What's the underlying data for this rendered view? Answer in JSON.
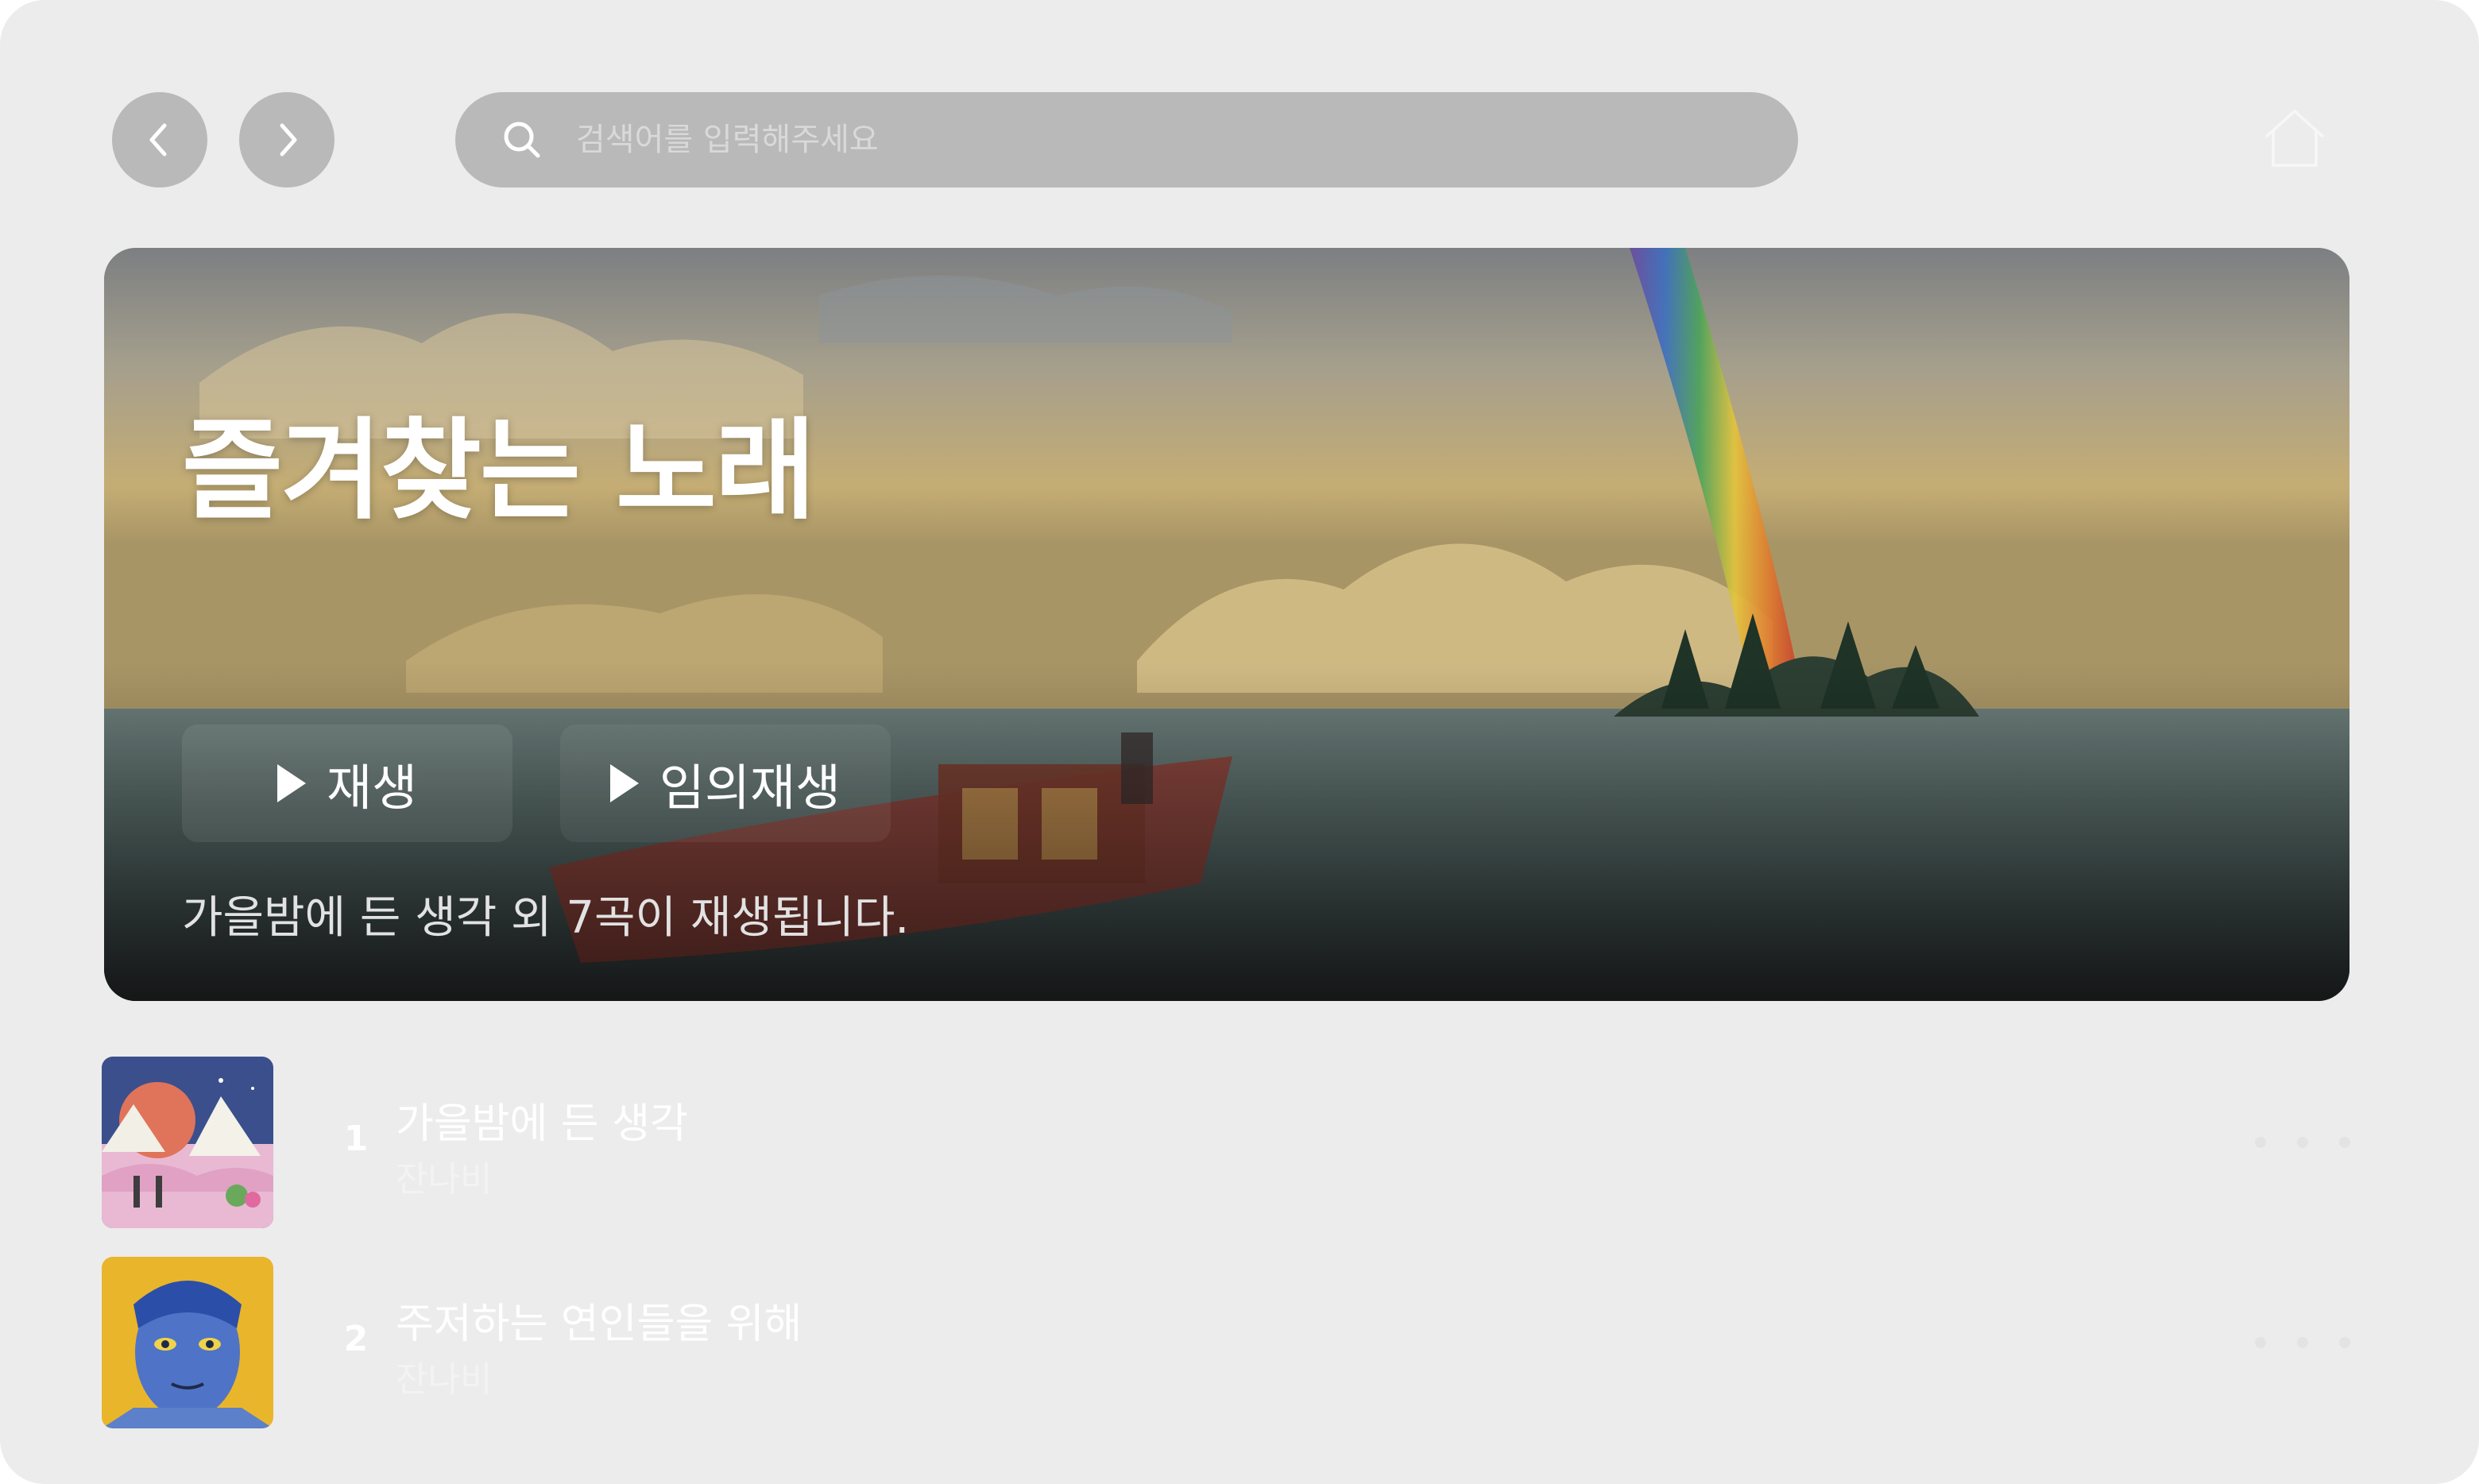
{
  "search": {
    "placeholder": "검색어를 입력해주세요"
  },
  "hero": {
    "title": "즐겨찾는 노래",
    "play_label": "재생",
    "shuffle_label": "임의재생",
    "subtitle": "가을밤에 든 생각 외 7곡이 재생됩니다."
  },
  "tracks": [
    {
      "num": "1",
      "title": "가을밤에 든 생각",
      "artist": "잔나비"
    },
    {
      "num": "2",
      "title": "주저하는 연인들을 위해",
      "artist": "잔나비"
    }
  ],
  "colors": {
    "background": "#ececec",
    "pill": "#b9b9b9",
    "text_light": "#ffffff"
  },
  "icons": [
    "chevron-left-icon",
    "chevron-right-icon",
    "search-icon",
    "home-icon",
    "play-icon",
    "more-icon"
  ]
}
